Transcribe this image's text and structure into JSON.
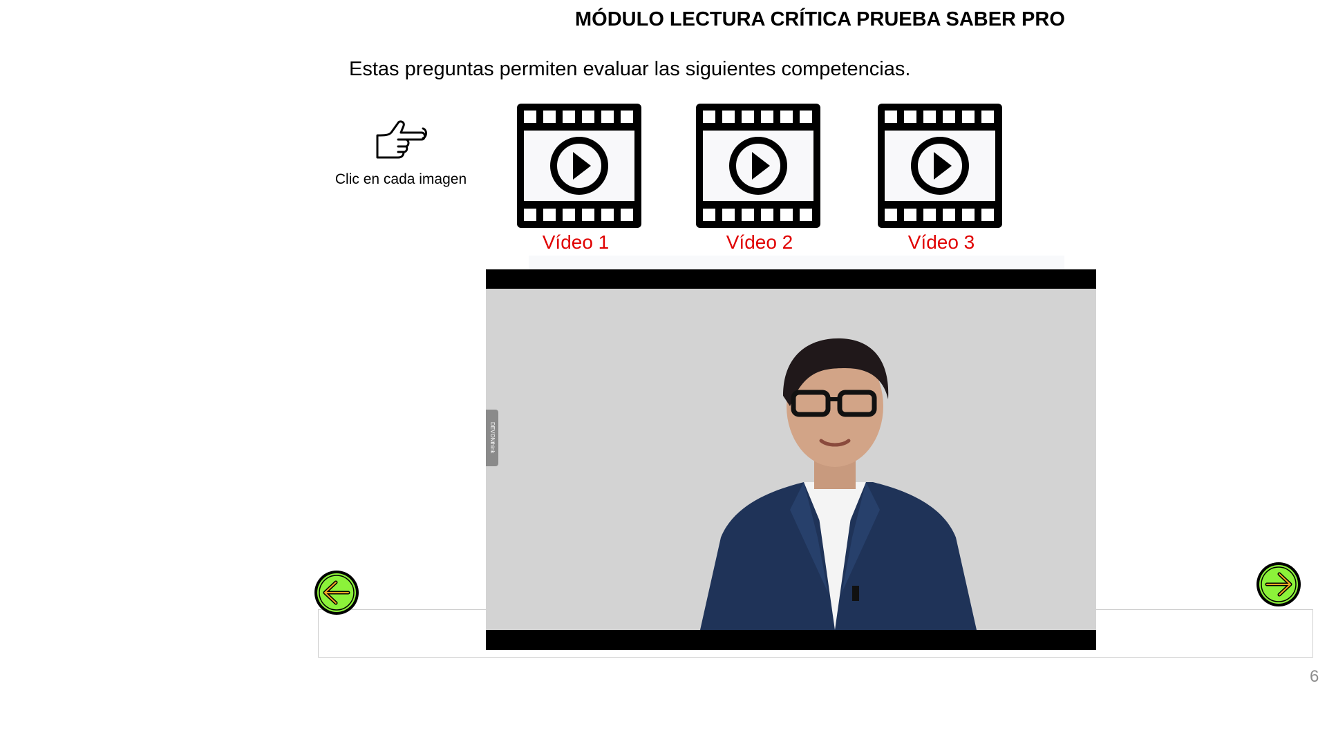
{
  "header": {
    "title": "MÓDULO LECTURA CRÍTICA PRUEBA SABER PRO",
    "subtitle": "Estas preguntas permiten evaluar las siguientes competencias."
  },
  "hint": {
    "icon": "pointing-hand-icon",
    "label": "Clic en cada imagen"
  },
  "videos": [
    {
      "label": "Vídeo 1",
      "icon": "film-play-icon"
    },
    {
      "label": "Vídeo 2",
      "icon": "film-play-icon"
    },
    {
      "label": "Vídeo 3",
      "icon": "film-play-icon"
    }
  ],
  "player": {
    "side_tab_label": "DEVONthink"
  },
  "navigation": {
    "prev_icon": "arrow-left-icon",
    "next_icon": "arrow-right-icon",
    "button_color": "#8cf23a"
  },
  "footer": {
    "page_number": "6"
  },
  "colors": {
    "video_label": "#e00000",
    "player_background": "#d3d3d3"
  }
}
